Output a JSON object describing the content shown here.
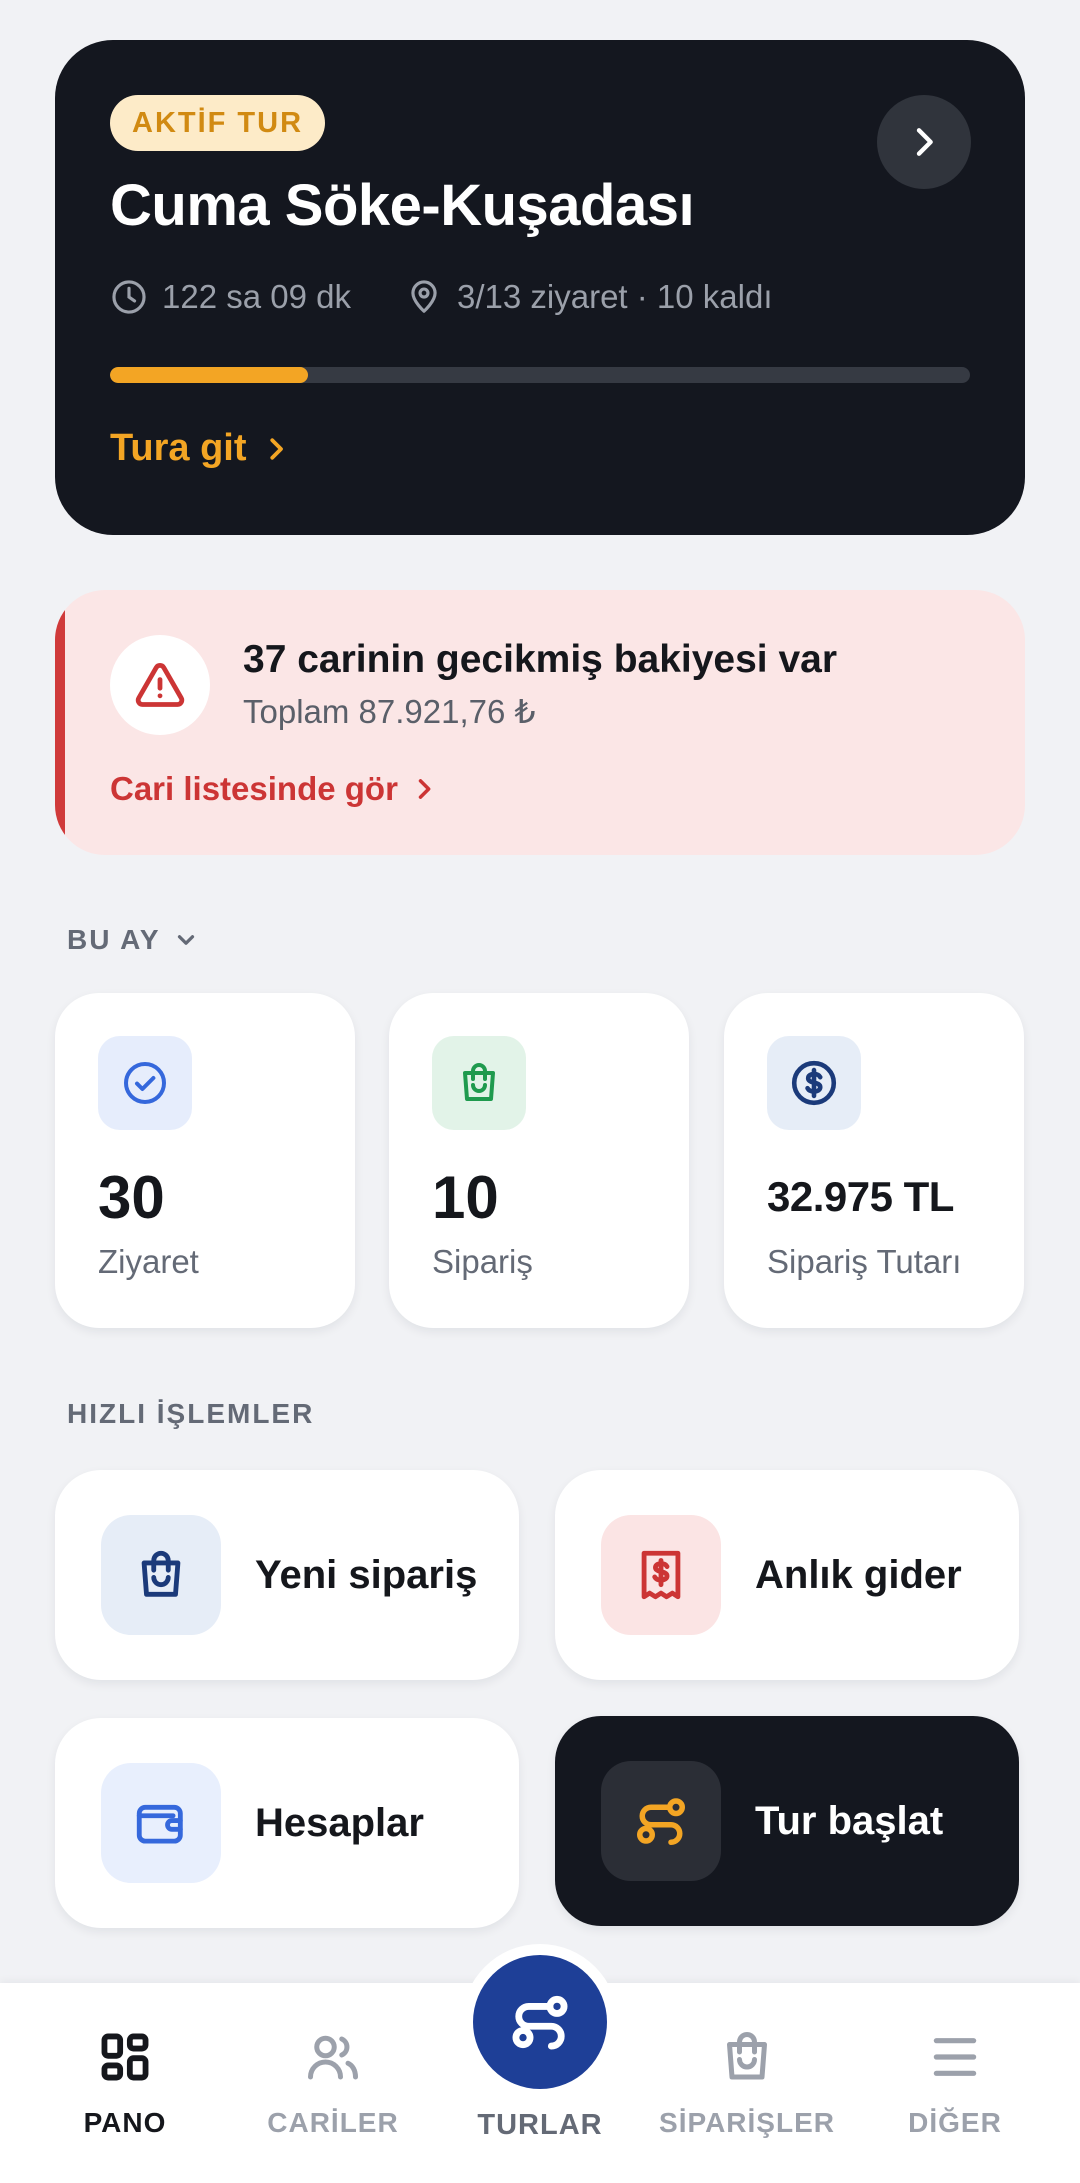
{
  "active_tour": {
    "badge": "AKTİF TUR",
    "title": "Cuma Söke-Kuşadası",
    "duration": "122 sa 09 dk",
    "visits": "3/13 ziyaret · 10 kaldı",
    "progress_fraction": 0.23,
    "link_label": "Tura git"
  },
  "alert": {
    "title": "37 carinin gecikmiş bakiyesi var",
    "subtitle": "Toplam 87.921,76 ₺",
    "link_label": "Cari listesinde gör"
  },
  "period": {
    "label": "BU AY"
  },
  "stats": [
    {
      "value": "30",
      "label": "Ziyaret",
      "icon": "check-circle-icon"
    },
    {
      "value": "10",
      "label": "Sipariş",
      "icon": "shopping-bag-icon"
    },
    {
      "value": "32.975 TL",
      "label": "Sipariş Tutarı",
      "icon": "dollar-circle-icon"
    }
  ],
  "quick_actions_title": "HIZLI İŞLEMLER",
  "quick_actions": [
    {
      "label": "Yeni sipariş",
      "icon": "shopping-bag-icon"
    },
    {
      "label": "Anlık gider",
      "icon": "receipt-icon"
    },
    {
      "label": "Hesaplar",
      "icon": "wallet-icon"
    },
    {
      "label": "Tur başlat",
      "icon": "route-icon"
    }
  ],
  "nav": [
    {
      "label": "PANO",
      "icon": "grid-icon",
      "active": true
    },
    {
      "label": "CARİLER",
      "icon": "users-icon"
    },
    {
      "label": "TURLAR",
      "icon": "route-icon"
    },
    {
      "label": "SİPARİŞLER",
      "icon": "shopping-bag-icon"
    },
    {
      "label": "DİĞER",
      "icon": "menu-icon"
    }
  ],
  "colors": {
    "accent": "#f3a524",
    "dark": "#14171f",
    "danger": "#d03a3a",
    "primary": "#1e3f97"
  }
}
